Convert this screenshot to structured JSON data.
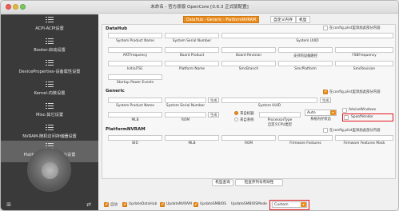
{
  "window": {
    "title": "未命名 - 官方原版 OpenCore [0.6.3 正式版配置]"
  },
  "sidebar": {
    "items": [
      {
        "label": "ACPI-ACPI设置"
      },
      {
        "label": "Booter-启动设置"
      },
      {
        "label": "DeviceProperties-设备属性设置"
      },
      {
        "label": "Kernel-内核设置"
      },
      {
        "label": "Misc-其它设置"
      },
      {
        "label": "NVRAM-随机访问存储器设置"
      },
      {
        "label": "PlatformInfo-机型平台设置"
      },
      {
        "label": "UEFI-UEFI设置"
      }
    ],
    "selected_index": 6
  },
  "tabs": [
    "DataHub - Generic - PlatformNVRAM",
    "自定义内存",
    "机型"
  ],
  "datahub": {
    "title": "DataHub",
    "row1": [
      "System Product Name",
      "System Serial Number",
      "System UUID"
    ],
    "row2": [
      "ARTFrequency",
      "Board Product",
      "Board Revision",
      "支持的设备路径",
      "FSBFrequency"
    ],
    "row3": [
      "InitialTSC",
      "Platform Name",
      "SmcBranch",
      "SmcPlatform",
      "SmcRevision"
    ],
    "row4": [
      "Startup Power Events"
    ],
    "note": "在config.plist里添加此部分内容"
  },
  "generic": {
    "title": "Generic",
    "note": "在config.plist里添加此部分内容",
    "row1": [
      "System Product Name",
      "System Serial Number",
      "System UUID"
    ],
    "gen_label": "生成",
    "radio1": "来自机器",
    "radio2": "来自系统",
    "row2": [
      "MLB",
      "ROM",
      "ProcessorType",
      "系统内存状态"
    ],
    "processor_sub": "自定义CPU类型",
    "memory_value": "Auto",
    "chk1": "AdviseWindows",
    "chk2": "SpoofVendor"
  },
  "platformnvram": {
    "title": "PlatformNVRAM",
    "note": "在config.plist里添加此部分内容",
    "row1": [
      "BID",
      "MLB",
      "ROM",
      "Firmware Features",
      "Firmware Features Mask"
    ]
  },
  "actions": {
    "lookup": "机型查询",
    "check": "检查序列号有效性"
  },
  "bottom": {
    "auto": "自动",
    "c1": "UpdateDataHub",
    "c2": "UpdateNVRAM",
    "c3": "UpdateSMBIOS",
    "mode_label": "UpdateSMBIOSMode",
    "mode_value": "Custom"
  },
  "colors": {
    "accent": "#e98c1f",
    "sidebar": "#3a3a3a",
    "highlight": "#e0141c"
  }
}
